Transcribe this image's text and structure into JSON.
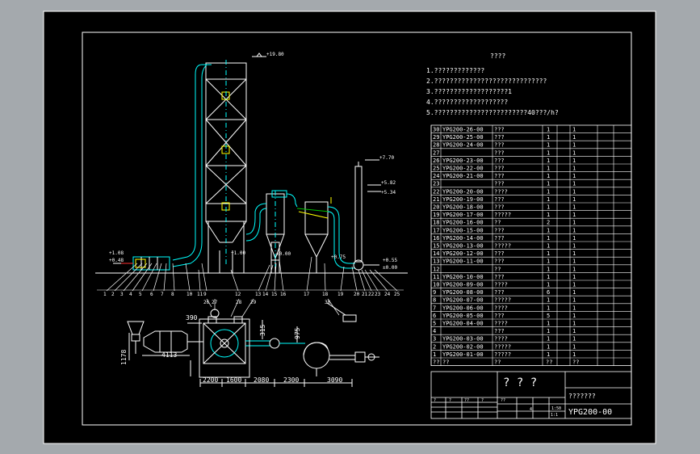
{
  "colors": {
    "viewport_bg": "#a4a9ad",
    "canvas": "#000000",
    "line": "#ffffff",
    "cyan": "#00ffff",
    "yellow": "#ffff00",
    "green": "#00c000",
    "red": "#ff3030"
  },
  "title": "????",
  "notes": [
    "1.?????????????",
    "2.?????????????????????????????",
    "3.???????????????????1",
    "4.???????????????????",
    "5.????????????????????????40???/h?"
  ],
  "elevations": {
    "top": "+19.80",
    "e770": "+7.70",
    "e582": "+5.82",
    "e534": "+5.34",
    "e108": "+1.08",
    "e048": "+0.48",
    "e100": "+1.00",
    "e055": "+0.55",
    "e000a": "±0.00",
    "e000b": "±0.00",
    "e075": "+0.75"
  },
  "callouts": [
    "1",
    "2",
    "3",
    "4",
    "5",
    "6",
    "7",
    "8",
    "9",
    "10",
    "11",
    "12",
    "13",
    "14",
    "15",
    "16",
    "17",
    "18",
    "19",
    "20",
    "21",
    "22",
    "23",
    "24",
    "25",
    "26",
    "27",
    "28",
    "29",
    "30"
  ],
  "plan_dims": {
    "d390": "390",
    "d4113": "4113",
    "d1178": "1178",
    "d315": "315",
    "d975": "975",
    "row": [
      "2200",
      "1600",
      "2080",
      "2300",
      "3090"
    ]
  },
  "bom": [
    {
      "no": "30",
      "code": "YPG200-26-00",
      "name": "???",
      "q": "1",
      "m": "1"
    },
    {
      "no": "29",
      "code": "YPG200-25-00",
      "name": "???",
      "q": "1",
      "m": "1"
    },
    {
      "no": "28",
      "code": "YPG200-24-00",
      "name": "???",
      "q": "1",
      "m": "1"
    },
    {
      "no": "27",
      "code": "",
      "name": "???",
      "q": "1",
      "m": "1"
    },
    {
      "no": "26",
      "code": "YPG200-23-00",
      "name": "???",
      "q": "1",
      "m": "1"
    },
    {
      "no": "25",
      "code": "YPG200-22-00",
      "name": "???",
      "q": "1",
      "m": "1"
    },
    {
      "no": "24",
      "code": "YPG200-21-00",
      "name": "???",
      "q": "1",
      "m": "1"
    },
    {
      "no": "23",
      "code": "",
      "name": "???",
      "q": "1",
      "m": "1"
    },
    {
      "no": "22",
      "code": "YPG200-20-00",
      "name": "????",
      "q": "1",
      "m": "1"
    },
    {
      "no": "21",
      "code": "YPG200-19-00",
      "name": "???",
      "q": "1",
      "m": "1"
    },
    {
      "no": "20",
      "code": "YPG200-18-00",
      "name": "???",
      "q": "1",
      "m": "1"
    },
    {
      "no": "19",
      "code": "YPG200-17-00",
      "name": "?????",
      "q": "1",
      "m": "1"
    },
    {
      "no": "18",
      "code": "YPG200-16-00",
      "name": "??",
      "q": "2",
      "m": "1"
    },
    {
      "no": "17",
      "code": "YPG200-15-00",
      "name": "???",
      "q": "1",
      "m": "1"
    },
    {
      "no": "16",
      "code": "YPG200-14-00",
      "name": "???",
      "q": "1",
      "m": "1"
    },
    {
      "no": "15",
      "code": "YPG200-13-00",
      "name": "?????",
      "q": "1",
      "m": "1"
    },
    {
      "no": "14",
      "code": "YPG200-12-00",
      "name": "???",
      "q": "1",
      "m": "1"
    },
    {
      "no": "13",
      "code": "YPG200-11-00",
      "name": "???",
      "q": "1",
      "m": "1"
    },
    {
      "no": "12",
      "code": "",
      "name": "??",
      "q": "1",
      "m": "1"
    },
    {
      "no": "11",
      "code": "YPG200-10-00",
      "name": "???",
      "q": "1",
      "m": "1"
    },
    {
      "no": "10",
      "code": "YPG200-09-00",
      "name": "????",
      "q": "1",
      "m": "1"
    },
    {
      "no": "9",
      "code": "YPG200-08-00",
      "name": "???",
      "q": "6",
      "m": "1"
    },
    {
      "no": "8",
      "code": "YPG200-07-00",
      "name": "?????",
      "q": "1",
      "m": "1"
    },
    {
      "no": "7",
      "code": "YPG200-06-00",
      "name": "????",
      "q": "1",
      "m": "1"
    },
    {
      "no": "6",
      "code": "YPG200-05-00",
      "name": "???",
      "q": "5",
      "m": "1"
    },
    {
      "no": "5",
      "code": "YPG200-04-00",
      "name": "????",
      "q": "1",
      "m": "1"
    },
    {
      "no": "4",
      "code": "",
      "name": "???",
      "q": "1",
      "m": "1"
    },
    {
      "no": "3",
      "code": "YPG200-03-00",
      "name": "????",
      "q": "1",
      "m": "1"
    },
    {
      "no": "2",
      "code": "YPG200-02-00",
      "name": "?????",
      "q": "1",
      "m": "1"
    },
    {
      "no": "1",
      "code": "YPG200-01-00",
      "name": "?????",
      "q": "1",
      "m": "1"
    }
  ],
  "bom_header": {
    "no": "??",
    "code": "??",
    "name": "??",
    "q": "??",
    "m": "??"
  },
  "title_block": {
    "marks": "? ? ?",
    "unit": "???????",
    "drawing_no": "YPG200-00",
    "scale": "1:1",
    "s4": "4",
    "s50": "1:50",
    "cells": [
      "?",
      "?",
      "??",
      "?",
      "??"
    ]
  }
}
